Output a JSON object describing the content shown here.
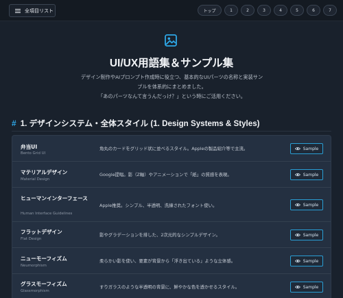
{
  "topbar": {
    "menu_label": "全項目リスト",
    "menu_icon": "hamburger-icon",
    "pager": [
      "トップ",
      "1",
      "2",
      "3",
      "4",
      "5",
      "6",
      "7"
    ]
  },
  "hero": {
    "icon": "image-icon",
    "accent": "#2ea8e8",
    "title": "UI/UX用語集＆サンプル集",
    "desc_lines": [
      "デザイン制作やAIプロンプト作成時に役立つ、基本的なUIパーツの名称と実装サン",
      "プルを体系的にまとめました。",
      "「あのパーツなんて言うんだっけ？」という時にご活用ください。"
    ]
  },
  "section": {
    "hash": "#",
    "title": "1. デザインシステム・全体スタイル (1. Design Systems & Styles)"
  },
  "items": [
    {
      "name": "弁当UI",
      "sub": "Bento Grid UI",
      "desc": "角丸のカードをグリッド状に並べるスタイル。Appleの製品紹介等で主流。",
      "button": "Sample"
    },
    {
      "name": "マテリアルデザイン",
      "sub": "Material Design",
      "desc": "Google提唱。影（Z軸）やアニメーションで「紙」の質感を表現。",
      "button": "Sample"
    },
    {
      "name": "ヒューマンインターフェース",
      "sub": "Human Interface Guidelines",
      "desc": "Apple推奨。シンプル、半透明、洗練されたフォント使い。",
      "button": "Sample"
    },
    {
      "name": "フラットデザイン",
      "sub": "Flat Design",
      "desc": "影やグラデーションを排した、2次元的なシンプルデザイン。",
      "button": "Sample"
    },
    {
      "name": "ニューモーフィズム",
      "sub": "Neumorphism",
      "desc": "柔らかい影を使い、要素が背景から「浮き出ている」ような立体感。",
      "button": "Sample"
    },
    {
      "name": "グラスモーフィズム",
      "sub": "Glassmorphism",
      "desc": "すりガラスのような半透明の背景に、鮮やかな色を透かせるスタイル。",
      "button": "Sample"
    }
  ]
}
